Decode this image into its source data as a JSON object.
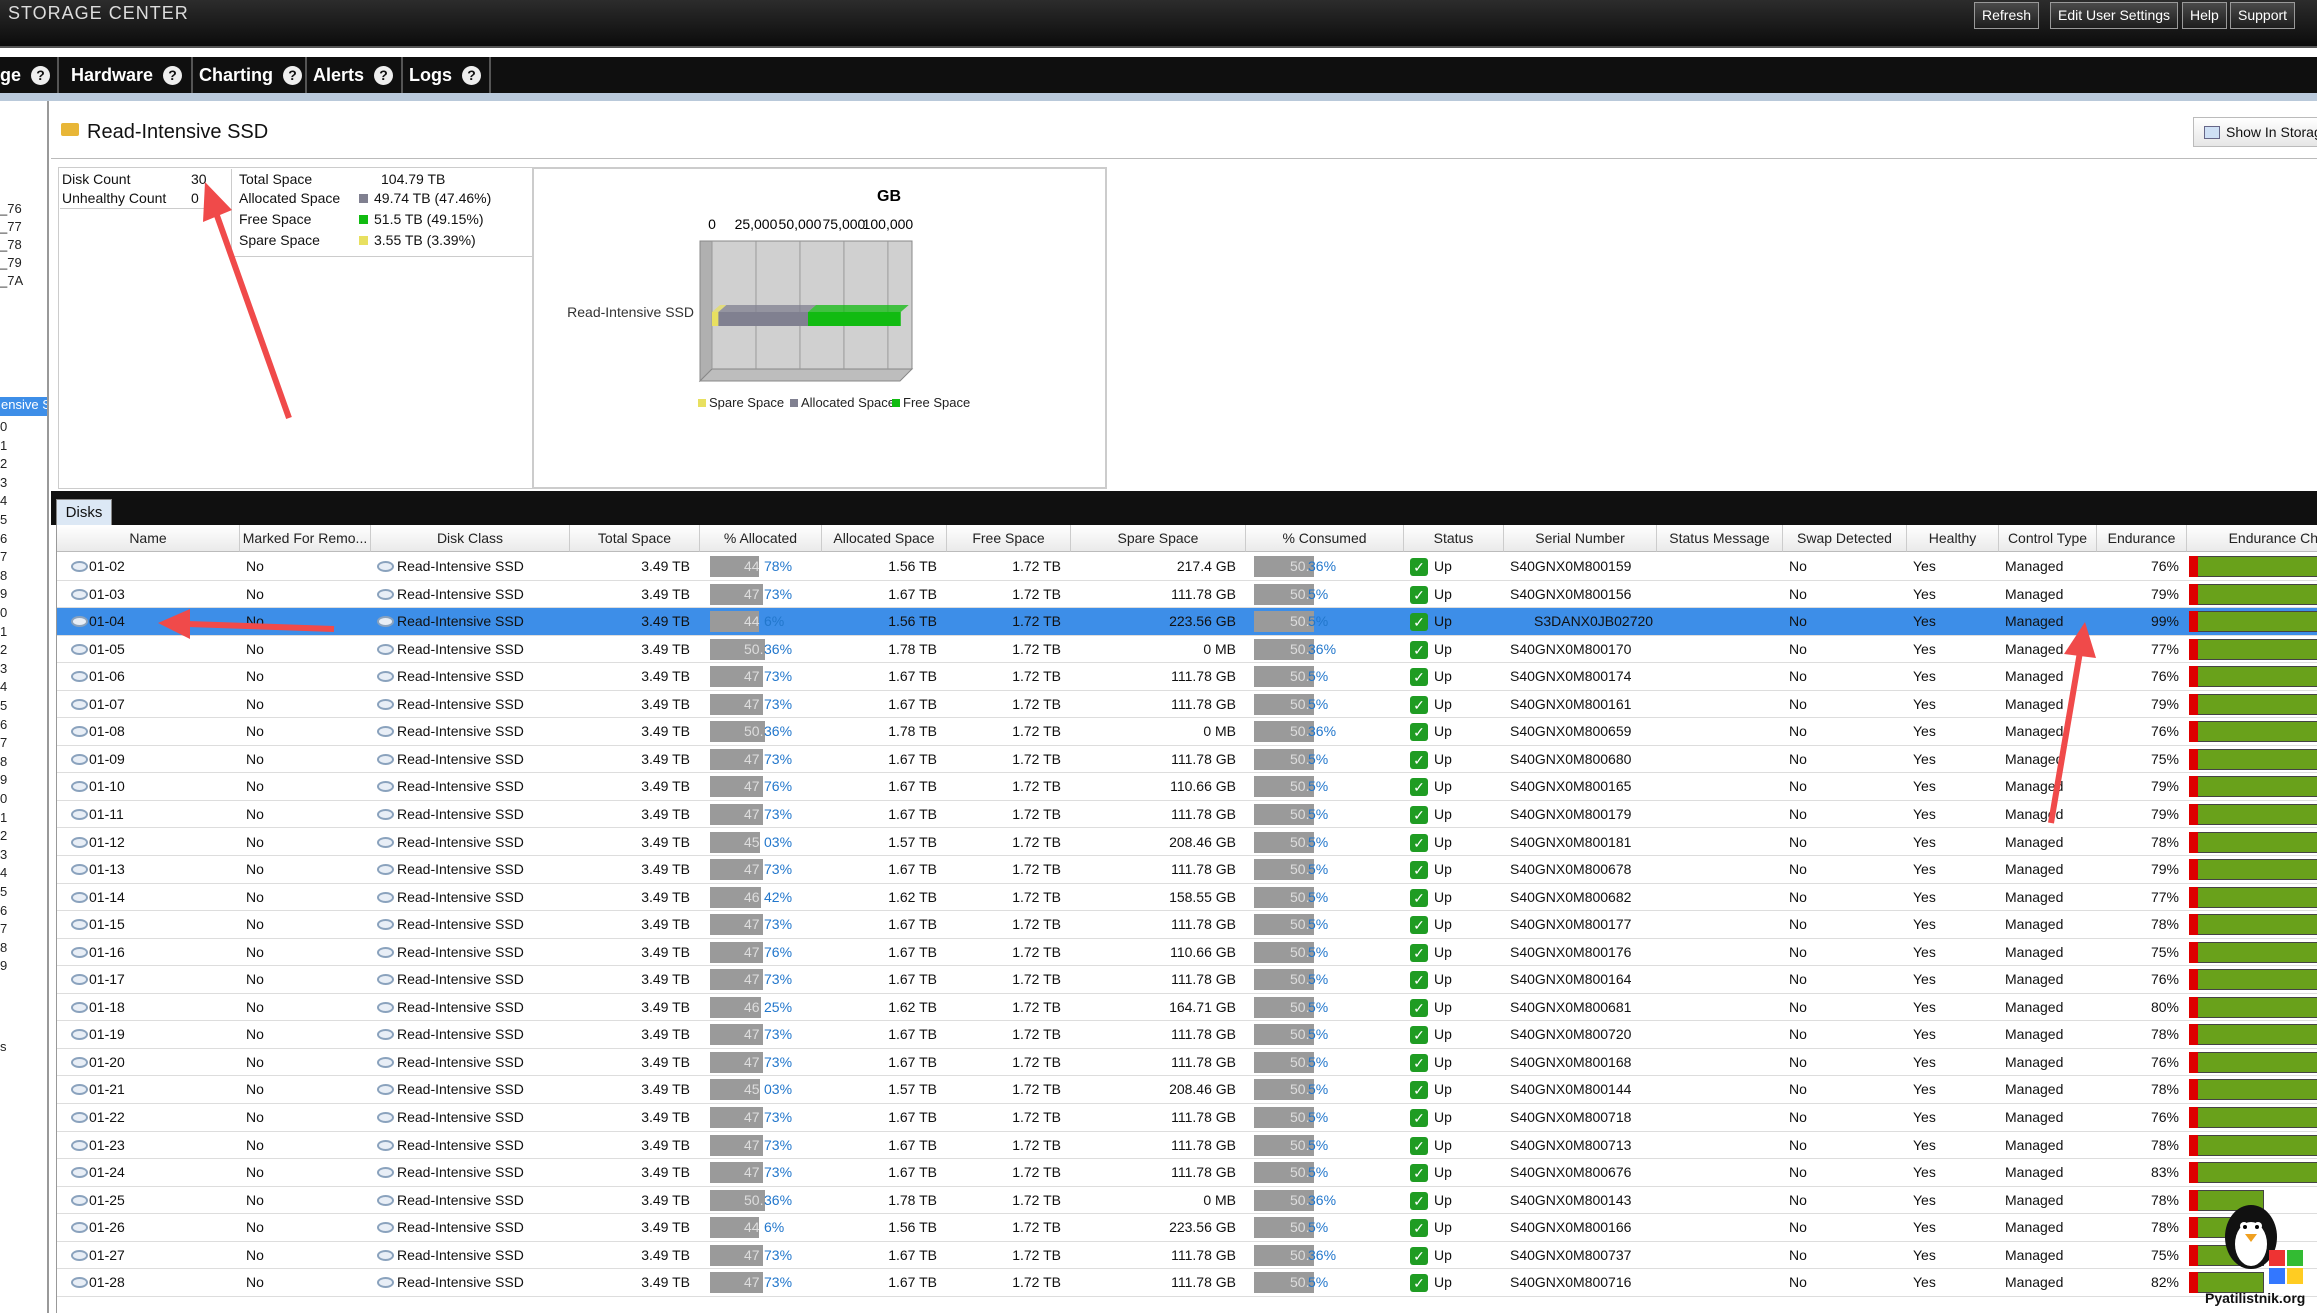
{
  "app": {
    "brand": "STORAGE CENTER"
  },
  "toolbar": {
    "refresh": "Refresh",
    "edit_user_settings": "Edit User Settings",
    "help": "Help",
    "support": "Support"
  },
  "nav": {
    "tabs": [
      {
        "label": "ge",
        "help": "?"
      },
      {
        "label": "Hardware",
        "help": "?"
      },
      {
        "label": "Charting",
        "help": "?"
      },
      {
        "label": "Alerts",
        "help": "?"
      },
      {
        "label": "Logs",
        "help": "?"
      }
    ]
  },
  "left_pane": {
    "items": [
      "_76",
      "_77",
      "_78",
      "_79",
      "_7A"
    ],
    "selected": "ensive S",
    "digits": [
      "0",
      "1",
      "2",
      "3",
      "4",
      "5",
      "6",
      "7",
      "8",
      "9",
      "0",
      "1",
      "2",
      "3",
      "4",
      "5",
      "6",
      "7",
      "8",
      "9",
      "0",
      "1",
      "2",
      "3",
      "4",
      "5",
      "6",
      "7",
      "8",
      "9"
    ],
    "trailer": "s"
  },
  "page": {
    "title": "Read-Intensive SSD",
    "show_button": "Show In Storag"
  },
  "summary": {
    "disk_count_label": "Disk Count",
    "disk_count": "30",
    "unhealthy_label": "Unhealthy Count",
    "unhealthy": "0",
    "total_label": "Total Space",
    "total": "104.79 TB",
    "allocated_label": "Allocated Space",
    "allocated": "49.74 TB",
    "allocated_pct": "(47.46%)",
    "free_label": "Free Space",
    "free": "51.5 TB",
    "free_pct": "(49.15%)",
    "spare_label": "Spare Space",
    "spare": "3.55 TB",
    "spare_pct": "(3.39%)",
    "colors": {
      "allocated": "#808090",
      "free": "#11bb11",
      "spare": "#e8e060"
    }
  },
  "chart_data": {
    "type": "bar",
    "orientation": "horizontal",
    "stacked": true,
    "title": "GB",
    "categories": [
      "Read-Intensive SSD"
    ],
    "x_ticks": [
      "0",
      "25,000",
      "50,000",
      "75,000",
      "100,000"
    ],
    "xlim": [
      0,
      110000
    ],
    "series": [
      {
        "name": "Spare Space",
        "values": [
          3635
        ],
        "color": "#e8e060"
      },
      {
        "name": "Allocated Space",
        "values": [
          50934
        ],
        "color": "#808090"
      },
      {
        "name": "Free Space",
        "values": [
          52736
        ],
        "color": "#11bb11"
      }
    ],
    "legend_position": "bottom"
  },
  "tabs": {
    "disks": "Disks"
  },
  "columns": [
    "Name",
    "Marked For Remo...",
    "Disk Class",
    "Total Space",
    "% Allocated",
    "Allocated Space",
    "Free Space",
    "Spare Space",
    "% Consumed",
    "Status",
    "Serial Number",
    "Status Message",
    "Swap Detected",
    "Healthy",
    "Control Type",
    "Endurance",
    "Endurance Chart"
  ],
  "disks": [
    {
      "name": "01-02",
      "marked": "No",
      "class": "Read-Intensive SSD",
      "total": "3.49 TB",
      "alloc_pct": "44.78%",
      "alloc_bar": 44.78,
      "pa": "44",
      "pb": "78%",
      "allocated": "1.56 TB",
      "free": "1.72 TB",
      "spare": "217.4 GB",
      "cons_a": "50.",
      "cons_b": "36%",
      "cons_bar": 50,
      "status": "Up",
      "serial": "S40GNX0M800159",
      "swap": "No",
      "healthy": "Yes",
      "control": "Managed",
      "endurance": "76%",
      "end_val": 76
    },
    {
      "name": "01-03",
      "marked": "No",
      "class": "Read-Intensive SSD",
      "total": "3.49 TB",
      "alloc_pct": "47.73%",
      "alloc_bar": 47.73,
      "pa": "47",
      "pb": "73%",
      "allocated": "1.67 TB",
      "free": "1.72 TB",
      "spare": "111.78 GB",
      "cons_a": "50.",
      "cons_b": "5%",
      "cons_bar": 50,
      "status": "Up",
      "serial": "S40GNX0M800156",
      "swap": "No",
      "healthy": "Yes",
      "control": "Managed",
      "endurance": "79%",
      "end_val": 79
    },
    {
      "name": "01-04",
      "marked": "No",
      "class": "Read-Intensive SSD",
      "total": "3.49 TB",
      "alloc_pct": "44.6%",
      "alloc_bar": 44.6,
      "pa": "44",
      "pb": "6%",
      "allocated": "1.56 TB",
      "free": "1.72 TB",
      "spare": "223.56 GB",
      "cons_a": "50.",
      "cons_b": "5%",
      "cons_bar": 50,
      "status": "Up",
      "serial": "S3DANX0JB02720",
      "swap": "No",
      "healthy": "Yes",
      "control": "Managed",
      "endurance": "99%",
      "end_val": 99,
      "selected": true
    },
    {
      "name": "01-05",
      "marked": "No",
      "class": "Read-Intensive SSD",
      "total": "3.49 TB",
      "alloc_pct": "50.36%",
      "alloc_bar": 50.36,
      "pa": "50.",
      "pb": "36%",
      "allocated": "1.78 TB",
      "free": "1.72 TB",
      "spare": "0 MB",
      "cons_a": "50.",
      "cons_b": "36%",
      "cons_bar": 50,
      "status": "Up",
      "serial": "S40GNX0M800170",
      "swap": "No",
      "healthy": "Yes",
      "control": "Managed",
      "endurance": "77%",
      "end_val": 77
    },
    {
      "name": "01-06",
      "marked": "No",
      "class": "Read-Intensive SSD",
      "total": "3.49 TB",
      "alloc_pct": "47.73%",
      "alloc_bar": 47.73,
      "pa": "47",
      "pb": "73%",
      "allocated": "1.67 TB",
      "free": "1.72 TB",
      "spare": "111.78 GB",
      "cons_a": "50.",
      "cons_b": "5%",
      "cons_bar": 50,
      "status": "Up",
      "serial": "S40GNX0M800174",
      "swap": "No",
      "healthy": "Yes",
      "control": "Managed",
      "endurance": "76%",
      "end_val": 76
    },
    {
      "name": "01-07",
      "marked": "No",
      "class": "Read-Intensive SSD",
      "total": "3.49 TB",
      "alloc_pct": "47.73%",
      "alloc_bar": 47.73,
      "pa": "47",
      "pb": "73%",
      "allocated": "1.67 TB",
      "free": "1.72 TB",
      "spare": "111.78 GB",
      "cons_a": "50.",
      "cons_b": "5%",
      "cons_bar": 50,
      "status": "Up",
      "serial": "S40GNX0M800161",
      "swap": "No",
      "healthy": "Yes",
      "control": "Managed",
      "endurance": "79%",
      "end_val": 79
    },
    {
      "name": "01-08",
      "marked": "No",
      "class": "Read-Intensive SSD",
      "total": "3.49 TB",
      "alloc_pct": "50.36%",
      "alloc_bar": 50.36,
      "pa": "50.",
      "pb": "36%",
      "allocated": "1.78 TB",
      "free": "1.72 TB",
      "spare": "0 MB",
      "cons_a": "50.",
      "cons_b": "36%",
      "cons_bar": 50,
      "status": "Up",
      "serial": "S40GNX0M800659",
      "swap": "No",
      "healthy": "Yes",
      "control": "Managed",
      "endurance": "76%",
      "end_val": 76
    },
    {
      "name": "01-09",
      "marked": "No",
      "class": "Read-Intensive SSD",
      "total": "3.49 TB",
      "alloc_pct": "47.73%",
      "alloc_bar": 47.73,
      "pa": "47",
      "pb": "73%",
      "allocated": "1.67 TB",
      "free": "1.72 TB",
      "spare": "111.78 GB",
      "cons_a": "50.",
      "cons_b": "5%",
      "cons_bar": 50,
      "status": "Up",
      "serial": "S40GNX0M800680",
      "swap": "No",
      "healthy": "Yes",
      "control": "Managed",
      "endurance": "75%",
      "end_val": 75
    },
    {
      "name": "01-10",
      "marked": "No",
      "class": "Read-Intensive SSD",
      "total": "3.49 TB",
      "alloc_pct": "47.76%",
      "alloc_bar": 47.76,
      "pa": "47",
      "pb": "76%",
      "allocated": "1.67 TB",
      "free": "1.72 TB",
      "spare": "110.66 GB",
      "cons_a": "50.",
      "cons_b": "5%",
      "cons_bar": 50,
      "status": "Up",
      "serial": "S40GNX0M800165",
      "swap": "No",
      "healthy": "Yes",
      "control": "Managed",
      "endurance": "79%",
      "end_val": 79
    },
    {
      "name": "01-11",
      "marked": "No",
      "class": "Read-Intensive SSD",
      "total": "3.49 TB",
      "alloc_pct": "47.73%",
      "alloc_bar": 47.73,
      "pa": "47",
      "pb": "73%",
      "allocated": "1.67 TB",
      "free": "1.72 TB",
      "spare": "111.78 GB",
      "cons_a": "50.",
      "cons_b": "5%",
      "cons_bar": 50,
      "status": "Up",
      "serial": "S40GNX0M800179",
      "swap": "No",
      "healthy": "Yes",
      "control": "Managed",
      "endurance": "79%",
      "end_val": 79
    },
    {
      "name": "01-12",
      "marked": "No",
      "class": "Read-Intensive SSD",
      "total": "3.49 TB",
      "alloc_pct": "45.03%",
      "alloc_bar": 45.03,
      "pa": "45",
      "pb": "03%",
      "allocated": "1.57 TB",
      "free": "1.72 TB",
      "spare": "208.46 GB",
      "cons_a": "50.",
      "cons_b": "5%",
      "cons_bar": 50,
      "status": "Up",
      "serial": "S40GNX0M800181",
      "swap": "No",
      "healthy": "Yes",
      "control": "Managed",
      "endurance": "78%",
      "end_val": 78
    },
    {
      "name": "01-13",
      "marked": "No",
      "class": "Read-Intensive SSD",
      "total": "3.49 TB",
      "alloc_pct": "47.73%",
      "alloc_bar": 47.73,
      "pa": "47",
      "pb": "73%",
      "allocated": "1.67 TB",
      "free": "1.72 TB",
      "spare": "111.78 GB",
      "cons_a": "50.",
      "cons_b": "5%",
      "cons_bar": 50,
      "status": "Up",
      "serial": "S40GNX0M800678",
      "swap": "No",
      "healthy": "Yes",
      "control": "Managed",
      "endurance": "79%",
      "end_val": 79
    },
    {
      "name": "01-14",
      "marked": "No",
      "class": "Read-Intensive SSD",
      "total": "3.49 TB",
      "alloc_pct": "46.42%",
      "alloc_bar": 46.42,
      "pa": "46",
      "pb": "42%",
      "allocated": "1.62 TB",
      "free": "1.72 TB",
      "spare": "158.55 GB",
      "cons_a": "50.",
      "cons_b": "5%",
      "cons_bar": 50,
      "status": "Up",
      "serial": "S40GNX0M800682",
      "swap": "No",
      "healthy": "Yes",
      "control": "Managed",
      "endurance": "77%",
      "end_val": 77
    },
    {
      "name": "01-15",
      "marked": "No",
      "class": "Read-Intensive SSD",
      "total": "3.49 TB",
      "alloc_pct": "47.73%",
      "alloc_bar": 47.73,
      "pa": "47",
      "pb": "73%",
      "allocated": "1.67 TB",
      "free": "1.72 TB",
      "spare": "111.78 GB",
      "cons_a": "50.",
      "cons_b": "5%",
      "cons_bar": 50,
      "status": "Up",
      "serial": "S40GNX0M800177",
      "swap": "No",
      "healthy": "Yes",
      "control": "Managed",
      "endurance": "78%",
      "end_val": 78
    },
    {
      "name": "01-16",
      "marked": "No",
      "class": "Read-Intensive SSD",
      "total": "3.49 TB",
      "alloc_pct": "47.76%",
      "alloc_bar": 47.76,
      "pa": "47",
      "pb": "76%",
      "allocated": "1.67 TB",
      "free": "1.72 TB",
      "spare": "110.66 GB",
      "cons_a": "50.",
      "cons_b": "5%",
      "cons_bar": 50,
      "status": "Up",
      "serial": "S40GNX0M800176",
      "swap": "No",
      "healthy": "Yes",
      "control": "Managed",
      "endurance": "75%",
      "end_val": 75
    },
    {
      "name": "01-17",
      "marked": "No",
      "class": "Read-Intensive SSD",
      "total": "3.49 TB",
      "alloc_pct": "47.73%",
      "alloc_bar": 47.73,
      "pa": "47",
      "pb": "73%",
      "allocated": "1.67 TB",
      "free": "1.72 TB",
      "spare": "111.78 GB",
      "cons_a": "50.",
      "cons_b": "5%",
      "cons_bar": 50,
      "status": "Up",
      "serial": "S40GNX0M800164",
      "swap": "No",
      "healthy": "Yes",
      "control": "Managed",
      "endurance": "76%",
      "end_val": 76
    },
    {
      "name": "01-18",
      "marked": "No",
      "class": "Read-Intensive SSD",
      "total": "3.49 TB",
      "alloc_pct": "46.25%",
      "alloc_bar": 46.25,
      "pa": "46",
      "pb": "25%",
      "allocated": "1.62 TB",
      "free": "1.72 TB",
      "spare": "164.71 GB",
      "cons_a": "50.",
      "cons_b": "5%",
      "cons_bar": 50,
      "status": "Up",
      "serial": "S40GNX0M800681",
      "swap": "No",
      "healthy": "Yes",
      "control": "Managed",
      "endurance": "80%",
      "end_val": 80
    },
    {
      "name": "01-19",
      "marked": "No",
      "class": "Read-Intensive SSD",
      "total": "3.49 TB",
      "alloc_pct": "47.73%",
      "alloc_bar": 47.73,
      "pa": "47",
      "pb": "73%",
      "allocated": "1.67 TB",
      "free": "1.72 TB",
      "spare": "111.78 GB",
      "cons_a": "50.",
      "cons_b": "5%",
      "cons_bar": 50,
      "status": "Up",
      "serial": "S40GNX0M800720",
      "swap": "No",
      "healthy": "Yes",
      "control": "Managed",
      "endurance": "78%",
      "end_val": 78
    },
    {
      "name": "01-20",
      "marked": "No",
      "class": "Read-Intensive SSD",
      "total": "3.49 TB",
      "alloc_pct": "47.73%",
      "alloc_bar": 47.73,
      "pa": "47",
      "pb": "73%",
      "allocated": "1.67 TB",
      "free": "1.72 TB",
      "spare": "111.78 GB",
      "cons_a": "50.",
      "cons_b": "5%",
      "cons_bar": 50,
      "status": "Up",
      "serial": "S40GNX0M800168",
      "swap": "No",
      "healthy": "Yes",
      "control": "Managed",
      "endurance": "76%",
      "end_val": 76
    },
    {
      "name": "01-21",
      "marked": "No",
      "class": "Read-Intensive SSD",
      "total": "3.49 TB",
      "alloc_pct": "45.03%",
      "alloc_bar": 45.03,
      "pa": "45",
      "pb": "03%",
      "allocated": "1.57 TB",
      "free": "1.72 TB",
      "spare": "208.46 GB",
      "cons_a": "50.",
      "cons_b": "5%",
      "cons_bar": 50,
      "status": "Up",
      "serial": "S40GNX0M800144",
      "swap": "No",
      "healthy": "Yes",
      "control": "Managed",
      "endurance": "78%",
      "end_val": 78
    },
    {
      "name": "01-22",
      "marked": "No",
      "class": "Read-Intensive SSD",
      "total": "3.49 TB",
      "alloc_pct": "47.73%",
      "alloc_bar": 47.73,
      "pa": "47",
      "pb": "73%",
      "allocated": "1.67 TB",
      "free": "1.72 TB",
      "spare": "111.78 GB",
      "cons_a": "50.",
      "cons_b": "5%",
      "cons_bar": 50,
      "status": "Up",
      "serial": "S40GNX0M800718",
      "swap": "No",
      "healthy": "Yes",
      "control": "Managed",
      "endurance": "76%",
      "end_val": 76
    },
    {
      "name": "01-23",
      "marked": "No",
      "class": "Read-Intensive SSD",
      "total": "3.49 TB",
      "alloc_pct": "47.73%",
      "alloc_bar": 47.73,
      "pa": "47",
      "pb": "73%",
      "allocated": "1.67 TB",
      "free": "1.72 TB",
      "spare": "111.78 GB",
      "cons_a": "50.",
      "cons_b": "5%",
      "cons_bar": 50,
      "status": "Up",
      "serial": "S40GNX0M800713",
      "swap": "No",
      "healthy": "Yes",
      "control": "Managed",
      "endurance": "78%",
      "end_val": 78
    },
    {
      "name": "01-24",
      "marked": "No",
      "class": "Read-Intensive SSD",
      "total": "3.49 TB",
      "alloc_pct": "47.73%",
      "alloc_bar": 47.73,
      "pa": "47",
      "pb": "73%",
      "allocated": "1.67 TB",
      "free": "1.72 TB",
      "spare": "111.78 GB",
      "cons_a": "50.",
      "cons_b": "5%",
      "cons_bar": 50,
      "status": "Up",
      "serial": "S40GNX0M800676",
      "swap": "No",
      "healthy": "Yes",
      "control": "Managed",
      "endurance": "83%",
      "end_val": 83
    },
    {
      "name": "01-25",
      "marked": "No",
      "class": "Read-Intensive SSD",
      "total": "3.49 TB",
      "alloc_pct": "50.36%",
      "alloc_bar": 50.36,
      "pa": "50.",
      "pb": "36%",
      "allocated": "1.78 TB",
      "free": "1.72 TB",
      "spare": "0 MB",
      "cons_a": "50.",
      "cons_b": "36%",
      "cons_bar": 50,
      "status": "Up",
      "serial": "S40GNX0M800143",
      "swap": "No",
      "healthy": "Yes",
      "control": "Managed",
      "endurance": "78%",
      "end_val": 78
    },
    {
      "name": "01-26",
      "marked": "No",
      "class": "Read-Intensive SSD",
      "total": "3.49 TB",
      "alloc_pct": "44.6%",
      "alloc_bar": 44.6,
      "pa": "44",
      "pb": "6%",
      "allocated": "1.56 TB",
      "free": "1.72 TB",
      "spare": "223.56 GB",
      "cons_a": "50.",
      "cons_b": "5%",
      "cons_bar": 50,
      "status": "Up",
      "serial": "S40GNX0M800166",
      "swap": "No",
      "healthy": "Yes",
      "control": "Managed",
      "endurance": "78%",
      "end_val": 78
    },
    {
      "name": "01-27",
      "marked": "No",
      "class": "Read-Intensive SSD",
      "total": "3.49 TB",
      "alloc_pct": "47.73%",
      "alloc_bar": 47.73,
      "pa": "47",
      "pb": "73%",
      "allocated": "1.67 TB",
      "free": "1.72 TB",
      "spare": "111.78 GB",
      "cons_a": "50.",
      "cons_b": "36%",
      "cons_bar": 50,
      "status": "Up",
      "serial": "S40GNX0M800737",
      "swap": "No",
      "healthy": "Yes",
      "control": "Managed",
      "endurance": "75%",
      "end_val": 75
    },
    {
      "name": "01-28",
      "marked": "No",
      "class": "Read-Intensive SSD",
      "total": "3.49 TB",
      "alloc_pct": "47.73%",
      "alloc_bar": 47.73,
      "pa": "47",
      "pb": "73%",
      "allocated": "1.67 TB",
      "free": "1.72 TB",
      "spare": "111.78 GB",
      "cons_a": "50.",
      "cons_b": "5%",
      "cons_bar": 50,
      "status": "Up",
      "serial": "S40GNX0M800716",
      "swap": "No",
      "healthy": "Yes",
      "control": "Managed",
      "endurance": "82%",
      "end_val": 82
    }
  ],
  "watermark": "Pyatilistnik.org",
  "annotation_color": "#f04a4a"
}
